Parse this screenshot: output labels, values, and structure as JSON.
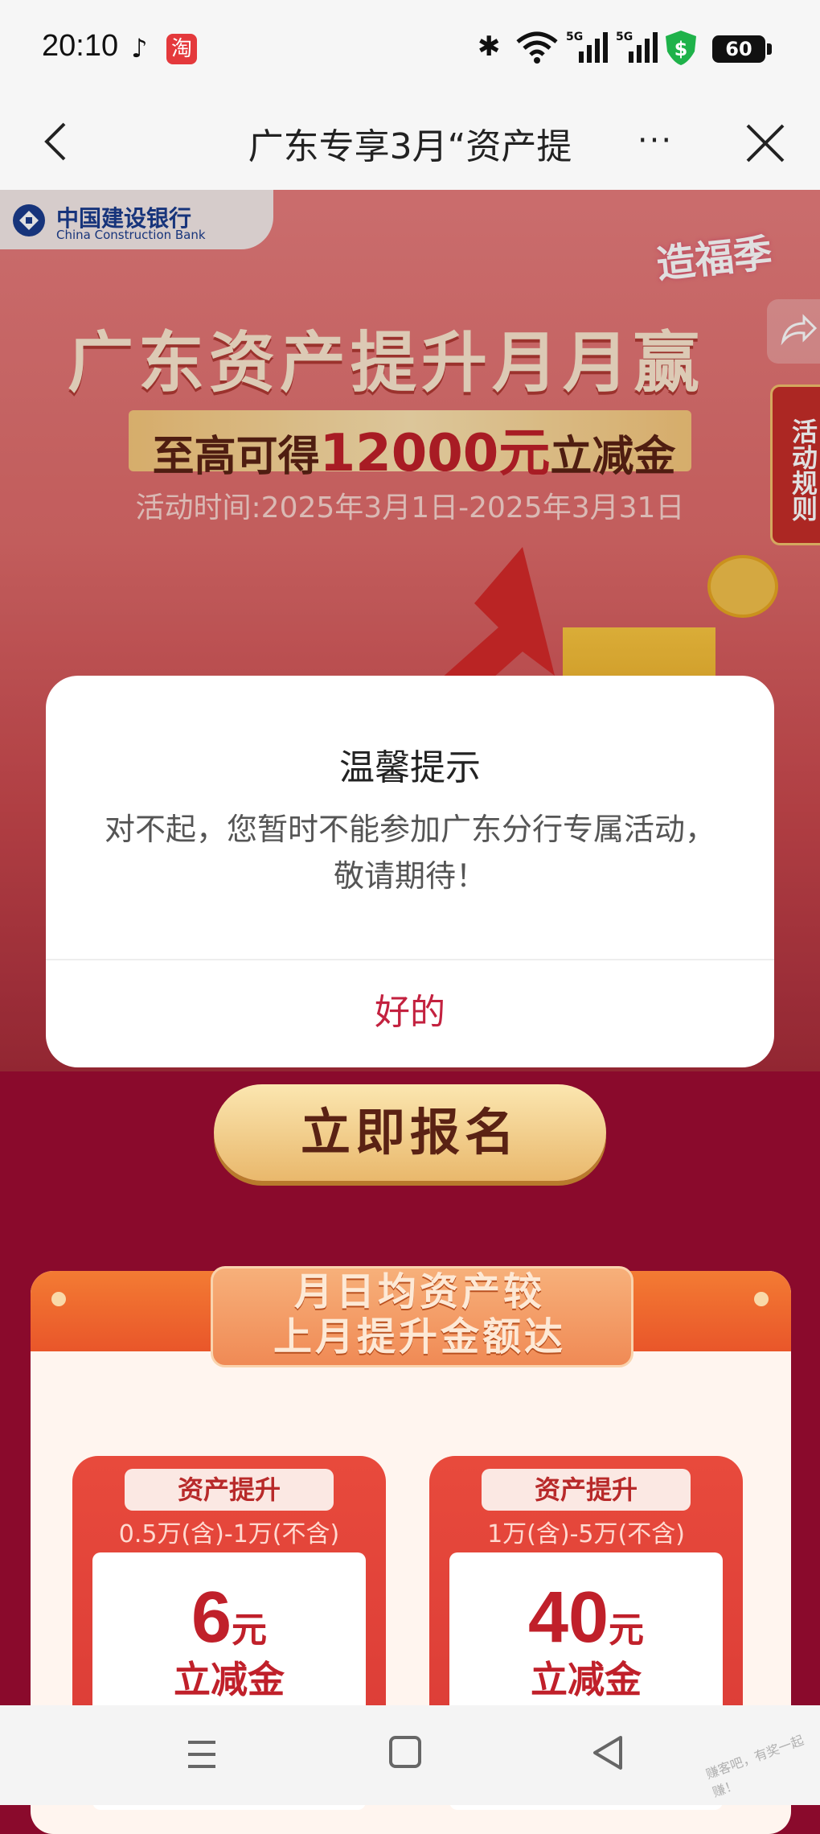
{
  "status_bar": {
    "time": "20:10",
    "taobao_glyph": "淘",
    "battery": "60",
    "signal_label_1": "5G",
    "signal_label_2": "5G",
    "icons": [
      "tiktok-icon",
      "taobao-icon",
      "bluetooth-icon",
      "wifi-icon",
      "signal-5g-icon",
      "signal-5g-icon",
      "shield-dollar-icon",
      "battery-icon"
    ]
  },
  "nav": {
    "title": "广东专享3月“资产提",
    "more": "···"
  },
  "banner": {
    "bank_name_cn": "中国建设银行",
    "bank_name_en": "China Construction Bank",
    "season_badge": "造福季",
    "headline": "广东资产提升月月赢",
    "subline_prefix": "至高可得",
    "subline_amount": "12000元",
    "subline_suffix": "立减金",
    "date": "活动时间:2025年3月1日-2025年3月31日",
    "rules_button": "活动规则"
  },
  "dialog": {
    "title": "温馨提示",
    "message": "对不起，您暂时不能参加广东分行专属活动，敬请期待！",
    "ok_label": "好的"
  },
  "signup_button": "立即报名",
  "panel": {
    "title_line1": "月日均资产较",
    "title_line2": "上月提升金额达",
    "cards": [
      {
        "tag": "资产提升",
        "range": "0.5万(含)-1万(不含)",
        "amount": "6",
        "unit": "元",
        "label": "立减金"
      },
      {
        "tag": "资产提升",
        "range": "1万(含)-5万(不含)",
        "amount": "40",
        "unit": "元",
        "label": "立减金"
      }
    ]
  },
  "watermark": "赚客吧，有奖一起赚！",
  "colors": {
    "accent_red": "#c3213f",
    "page_bg": "#8a0a2c",
    "bank_blue": "#1b3c8c"
  }
}
